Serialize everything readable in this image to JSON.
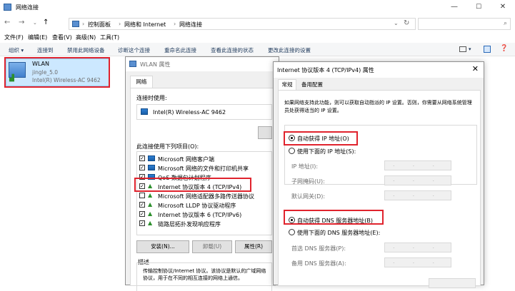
{
  "window": {
    "title": "网络连接"
  },
  "address": {
    "back": "←",
    "forward": "→",
    "up": "↑",
    "path": [
      "控制面板",
      "网络和 Internet",
      "网络连接"
    ],
    "sep": "›",
    "refresh": "↻"
  },
  "menu": [
    "文件(F)",
    "编辑(E)",
    "查看(V)",
    "高级(N)",
    "工具(T)"
  ],
  "commands": [
    "组织 ▾",
    "连接到",
    "禁用此网络设备",
    "诊断这个连接",
    "重命名此连接",
    "查看此连接的状态",
    "更改此连接的设置"
  ],
  "adapter": {
    "name": "WLAN",
    "ssid": "jingle_5.0",
    "device": "Intel(R) Wireless-AC 9462"
  },
  "props": {
    "title": "WLAN 属性",
    "tab": "网络",
    "connect_using": "连接时使用:",
    "device": "Intel(R) Wireless-AC 9462",
    "items_label": "此连接使用下列项目(O):",
    "items": [
      "Microsoft 网络客户端",
      "Microsoft 网络的文件和打印机共享",
      "QoS 数据包计划程序",
      "Internet 协议版本 4 (TCP/IPv4)",
      "Microsoft 网络适配器多路传送器协议",
      "Microsoft LLDP 协议驱动程序",
      "Internet 协议版本 6 (TCP/IPv6)",
      "链路层拓扑发现响应程序"
    ],
    "install": "安装(N)...",
    "uninstall": "卸载(U)",
    "properties": "属性(R)",
    "desc_label": "描述",
    "desc": "传输控制协议/Internet 协议。该协议是默认的广域网络协议，用于在不同的相互连接的网络上通信。"
  },
  "ipv4": {
    "title": "Internet 协议版本 4 (TCP/IPv4) 属性",
    "tabs": [
      "常规",
      "备用配置"
    ],
    "intro": "如果网络支持此功能，则可以获取自动指派的 IP 设置。否则，你需要从网络系统管理员处获得适当的 IP 设置。",
    "auto_ip": "自动获得 IP 地址(O)",
    "manual_ip": "使用下面的 IP 地址(S):",
    "ip_labels": [
      "IP 地址(I):",
      "子网掩码(U):",
      "默认网关(D):"
    ],
    "auto_dns": "自动获得 DNS 服务器地址(B)",
    "manual_dns": "使用下面的 DNS 服务器地址(E):",
    "dns_labels": [
      "首选 DNS 服务器(P):",
      "备用 DNS 服务器(A):"
    ],
    "ip_placeholder": ". . ."
  }
}
